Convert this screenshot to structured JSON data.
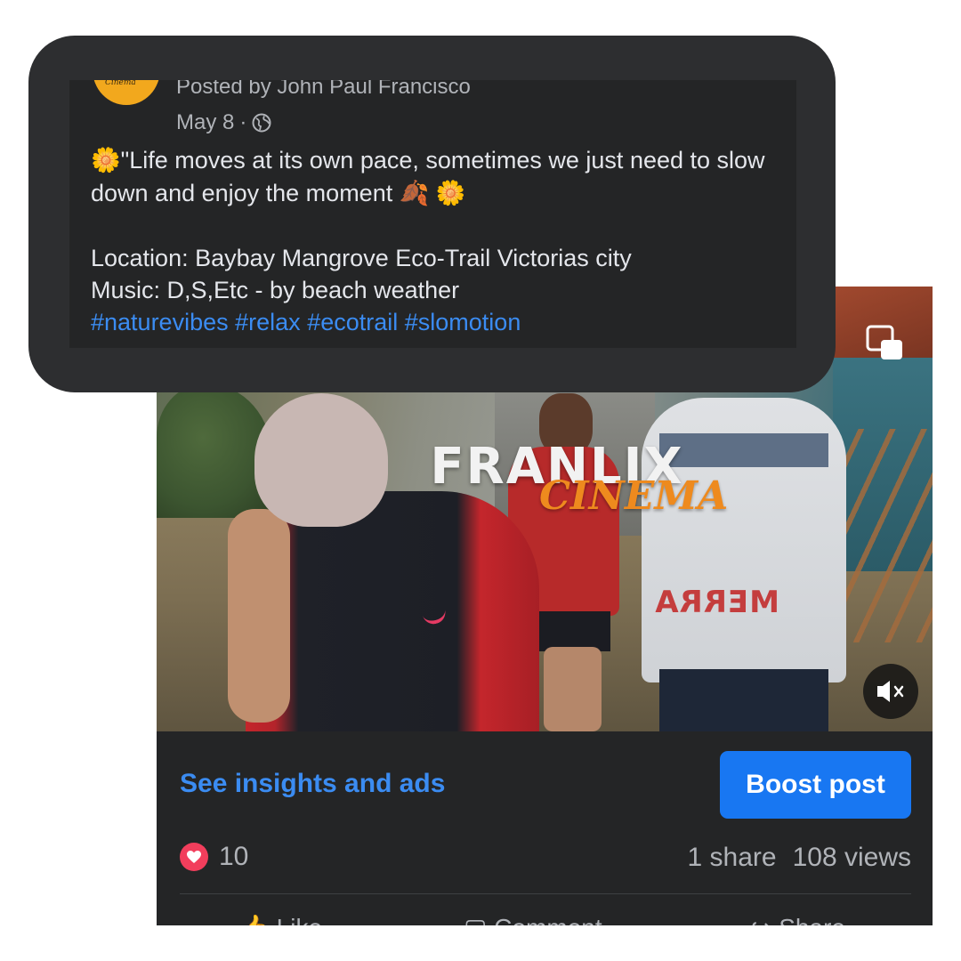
{
  "post": {
    "author_line": "Posted by John Paul Francisco",
    "date": "May 8",
    "separator": "·",
    "avatar_label": "Cinema",
    "caption": {
      "emoji_start": "🌼",
      "line1": "\"Life moves at its own pace, sometimes we just need to slow down and enjoy the moment",
      "emoji_leaves": "🍂",
      "emoji_end": "🌼",
      "location": "Location: Baybay Mangrove Eco-Trail Victorias city",
      "music": "Music: D,S,Etc - by beach weather",
      "hashtags": [
        "#naturevibes",
        "#relax",
        "#ecotrail",
        "#slomotion"
      ]
    }
  },
  "video": {
    "watermark_main": "FRANLIX",
    "watermark_sub": "CINEMA",
    "shirt_text": "MERRA"
  },
  "footer": {
    "insights_link": "See insights and ads",
    "boost_label": "Boost post",
    "reaction_count": "10",
    "shares": "1 share",
    "views": "108 views",
    "actions": [
      "Like",
      "Comment",
      "Share"
    ]
  },
  "colors": {
    "accent_blue": "#1877f2",
    "link_blue": "#3b8cf2",
    "love_red": "#f23e5c",
    "card_bg": "#242526"
  },
  "icons": [
    "globe-icon",
    "pip-icon",
    "mute-icon",
    "love-icon",
    "like-icon",
    "comment-icon",
    "share-icon"
  ]
}
